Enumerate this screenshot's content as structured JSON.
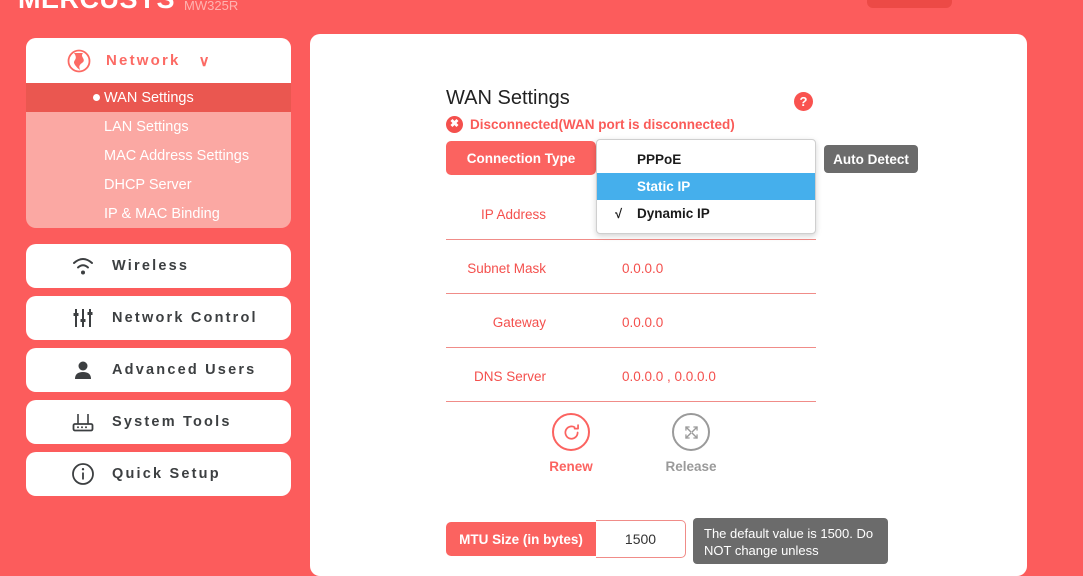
{
  "header": {
    "brand": "MERCUSYS",
    "model": "MW325R",
    "button_icon": "red-pill-button",
    "corner_glyph_icon": "white-glyph-icon"
  },
  "sidebar": {
    "network_group": {
      "label": "Network",
      "icon": "globe-icon",
      "chevron": "∨",
      "items": [
        {
          "label": "WAN Settings",
          "active": true
        },
        {
          "label": "LAN Settings",
          "active": false
        },
        {
          "label": "MAC Address Settings",
          "active": false
        },
        {
          "label": "DHCP Server",
          "active": false
        },
        {
          "label": "IP & MAC Binding",
          "active": false
        }
      ]
    },
    "buttons": [
      {
        "label": "Wireless",
        "icon": "wifi-icon"
      },
      {
        "label": "Network Control",
        "icon": "sliders-icon"
      },
      {
        "label": "Advanced Users",
        "icon": "user-icon"
      },
      {
        "label": "System Tools",
        "icon": "router-icon"
      },
      {
        "label": "Quick Setup",
        "icon": "info-circle-icon"
      }
    ]
  },
  "main": {
    "title": "WAN Settings",
    "help_icon_label": "?",
    "status": {
      "icon": "error-x-icon",
      "icon_glyph": "✖",
      "text": "Disconnected(WAN port is disconnected)"
    },
    "connection_type": {
      "label": "Connection Type",
      "auto_detect_label": "Auto Detect",
      "options": [
        {
          "label": "PPPoE",
          "selected": false,
          "checked": false
        },
        {
          "label": "Static IP",
          "selected": true,
          "checked": false
        },
        {
          "label": "Dynamic IP",
          "selected": false,
          "checked": true
        }
      ],
      "check_glyph": "√"
    },
    "fields": [
      {
        "label": "IP Address",
        "value": ""
      },
      {
        "label": "Subnet Mask",
        "value": "0.0.0.0"
      },
      {
        "label": "Gateway",
        "value": "0.0.0.0"
      },
      {
        "label": "DNS Server",
        "value": "0.0.0.0 , 0.0.0.0"
      }
    ],
    "actions": [
      {
        "label": "Renew",
        "icon": "refresh-icon",
        "state": "enabled"
      },
      {
        "label": "Release",
        "icon": "release-arrows-icon",
        "state": "disabled"
      }
    ],
    "mtu": {
      "label": "MTU Size (in bytes)",
      "value": "1500",
      "tooltip": "The default value is 1500. Do NOT change unless"
    }
  },
  "colors": {
    "background": "#fc5c5c",
    "accent": "#fb6360",
    "active_item": "#ea5750",
    "submenu": "#fba8a3",
    "select_highlight": "#45afec",
    "gray_button": "#6b6b6b"
  }
}
